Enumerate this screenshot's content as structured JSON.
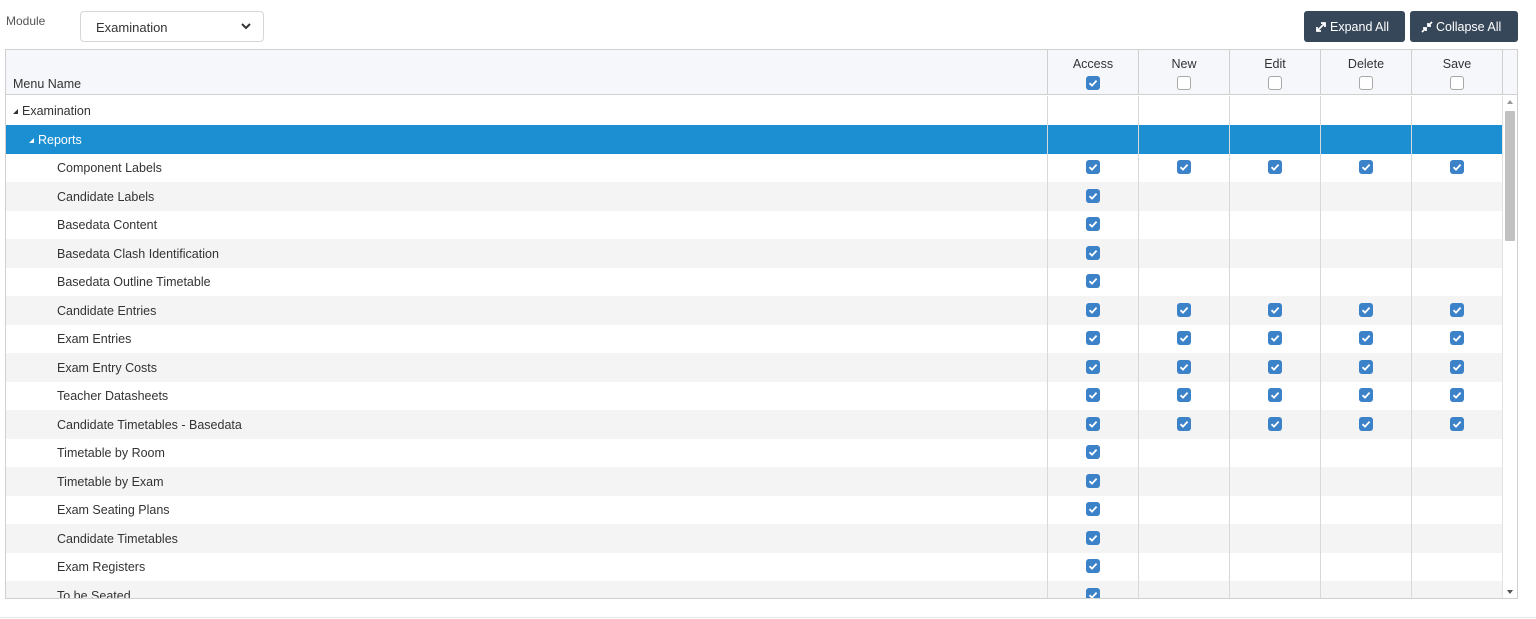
{
  "toolbar": {
    "module_label": "Module",
    "module_value": "Examination",
    "expand_label": "Expand All",
    "collapse_label": "Collapse All"
  },
  "columns": {
    "menu_name": "Menu Name",
    "access": {
      "label": "Access",
      "checked": true
    },
    "new": {
      "label": "New",
      "checked": false
    },
    "edit": {
      "label": "Edit",
      "checked": false
    },
    "delete": {
      "label": "Delete",
      "checked": false
    },
    "save": {
      "label": "Save",
      "checked": false
    }
  },
  "rows": [
    {
      "label": "Examination",
      "level": 0,
      "group": true,
      "perms": [
        null,
        null,
        null,
        null,
        null
      ]
    },
    {
      "label": "Reports",
      "level": 1,
      "group": true,
      "selected": true,
      "perms": [
        null,
        null,
        null,
        null,
        null
      ]
    },
    {
      "label": "Component Labels",
      "level": 2,
      "perms": [
        true,
        true,
        true,
        true,
        true
      ]
    },
    {
      "label": "Candidate Labels",
      "level": 2,
      "perms": [
        true,
        null,
        null,
        null,
        null
      ]
    },
    {
      "label": "Basedata Content",
      "level": 2,
      "perms": [
        true,
        null,
        null,
        null,
        null
      ]
    },
    {
      "label": "Basedata Clash Identification",
      "level": 2,
      "perms": [
        true,
        null,
        null,
        null,
        null
      ]
    },
    {
      "label": "Basedata Outline Timetable",
      "level": 2,
      "perms": [
        true,
        null,
        null,
        null,
        null
      ]
    },
    {
      "label": "Candidate Entries",
      "level": 2,
      "perms": [
        true,
        true,
        true,
        true,
        true
      ]
    },
    {
      "label": "Exam Entries",
      "level": 2,
      "perms": [
        true,
        true,
        true,
        true,
        true
      ]
    },
    {
      "label": "Exam Entry Costs",
      "level": 2,
      "perms": [
        true,
        true,
        true,
        true,
        true
      ]
    },
    {
      "label": "Teacher Datasheets",
      "level": 2,
      "perms": [
        true,
        true,
        true,
        true,
        true
      ]
    },
    {
      "label": "Candidate Timetables - Basedata",
      "level": 2,
      "perms": [
        true,
        true,
        true,
        true,
        true
      ]
    },
    {
      "label": "Timetable by Room",
      "level": 2,
      "perms": [
        true,
        null,
        null,
        null,
        null
      ]
    },
    {
      "label": "Timetable by Exam",
      "level": 2,
      "perms": [
        true,
        null,
        null,
        null,
        null
      ]
    },
    {
      "label": "Exam Seating Plans",
      "level": 2,
      "perms": [
        true,
        null,
        null,
        null,
        null
      ]
    },
    {
      "label": "Candidate Timetables",
      "level": 2,
      "perms": [
        true,
        null,
        null,
        null,
        null
      ]
    },
    {
      "label": "Exam Registers",
      "level": 2,
      "perms": [
        true,
        null,
        null,
        null,
        null
      ]
    },
    {
      "label": "To be Seated",
      "level": 2,
      "perms": [
        true,
        null,
        null,
        null,
        null
      ]
    }
  ],
  "colors": {
    "selected_row": "#1c8fd3",
    "checkbox_checked": "#3c82c8",
    "button_bg": "#37475a"
  },
  "icons": {
    "expand": "expand-arrows-icon",
    "collapse": "collapse-arrows-icon",
    "select": "chevron-down-icon",
    "tree_open": "triangle-open-icon"
  }
}
